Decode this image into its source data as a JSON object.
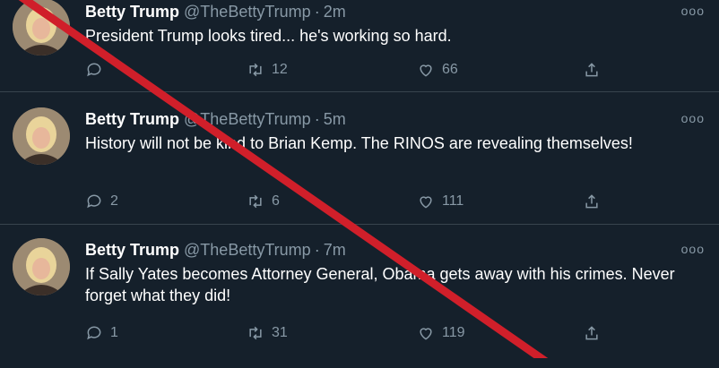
{
  "tweets": [
    {
      "name": "Betty Trump",
      "handle": "@TheBettyTrump",
      "separator": "·",
      "time": "2m",
      "text": "President Trump looks tired... he's working so hard.",
      "replies": "",
      "retweets": "12",
      "likes": "66"
    },
    {
      "name": "Betty Trump",
      "handle": "@TheBettyTrump",
      "separator": "·",
      "time": "5m",
      "text": "History will not be kind to Brian Kemp. The RINOS are revealing themselves!",
      "replies": "2",
      "retweets": "6",
      "likes": "111"
    },
    {
      "name": "Betty Trump",
      "handle": "@TheBettyTrump",
      "separator": "·",
      "time": "7m",
      "text": "If Sally Yates becomes Attorney General, Obama gets away with his crimes. Never forget what they did!",
      "replies": "1",
      "retweets": "31",
      "likes": "119"
    }
  ],
  "more_label": "ooo",
  "icons": {
    "reply": "reply-icon",
    "retweet": "retweet-icon",
    "like": "heart-icon",
    "share": "share-icon",
    "more": "more-icon"
  },
  "colors": {
    "background": "#15202b",
    "muted": "#8899a6",
    "divider": "#38444d",
    "slash": "#d01f2a"
  }
}
